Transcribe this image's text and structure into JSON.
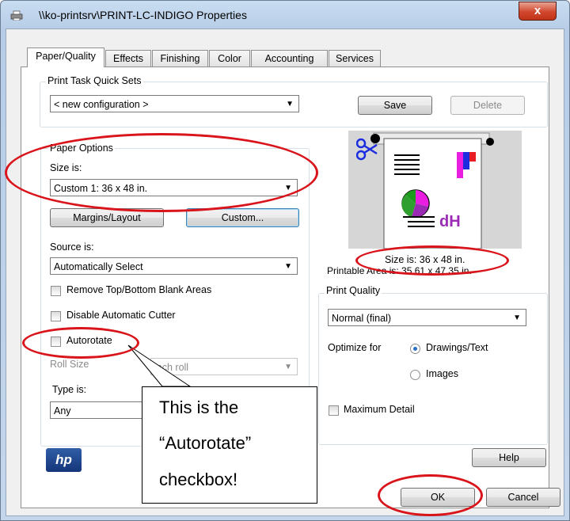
{
  "window": {
    "title": "\\\\ko-printsrv\\PRINT-LC-INDIGO Properties",
    "close_glyph": "x"
  },
  "tabs": [
    {
      "label": "Paper/Quality",
      "active": true
    },
    {
      "label": "Effects"
    },
    {
      "label": "Finishing"
    },
    {
      "label": "Color"
    },
    {
      "label": "Accounting"
    },
    {
      "label": "Services"
    }
  ],
  "quick_sets": {
    "legend": "Print Task Quick Sets",
    "value": "< new configuration >",
    "save_label": "Save",
    "delete_label": "Delete"
  },
  "paper_options": {
    "legend": "Paper Options",
    "size_label": "Size is:",
    "size_value": "Custom 1:  36  x  48 in.",
    "margins_button": "Margins/Layout",
    "custom_button": "Custom...",
    "source_label": "Source is:",
    "source_value": "Automatically Select",
    "remove_blank_label": "Remove Top/Bottom Blank Areas",
    "disable_cutter_label": "Disable Automatic Cutter",
    "autorotate_label": "Autorotate",
    "roll_size_label": "Roll Size",
    "roll_size_value": "inch roll",
    "type_label": "Type is:",
    "type_value": "Any"
  },
  "preview": {
    "size_text": "Size is:  36  x  48 in.",
    "printable_text": "Printable Area is:  35.61  x  47.35 in.",
    "logo_text": "dH"
  },
  "print_quality": {
    "legend": "Print Quality",
    "value": "Normal (final)",
    "optimize_label": "Optimize for",
    "option_drawings": "Drawings/Text",
    "option_images": "Images",
    "selected": "Drawings/Text",
    "max_detail_label": "Maximum Detail"
  },
  "footer": {
    "logo_text": "hp",
    "help_label": "Help",
    "ok_label": "OK",
    "cancel_label": "Cancel"
  },
  "callout": {
    "lines": [
      "This is the",
      "“Autorotate”",
      "checkbox!"
    ]
  },
  "colors": {
    "annotation_red": "#d9141b",
    "window_frame": "#b7cde7",
    "close_red": "#c13418"
  }
}
